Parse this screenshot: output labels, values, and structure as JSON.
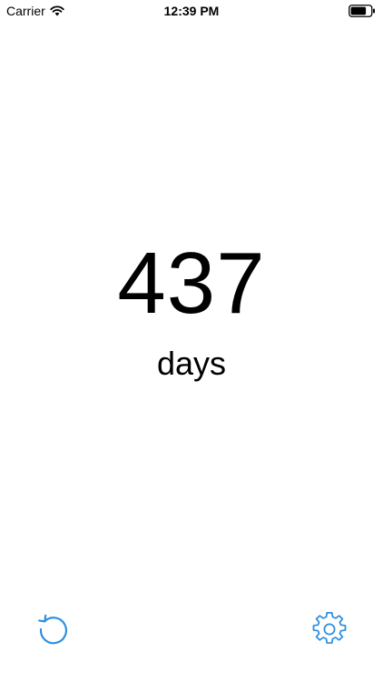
{
  "status_bar": {
    "carrier": "Carrier",
    "time": "12:39 PM",
    "icons": [
      "wifi-icon",
      "battery-icon"
    ]
  },
  "counter": {
    "value": "437",
    "unit": "days"
  },
  "toolbar": {
    "reset_icon": "refresh-icon",
    "settings_icon": "gear-icon"
  },
  "colors": {
    "accent": "#2F8FE0",
    "text": "#000000",
    "background": "#FFFFFF"
  }
}
